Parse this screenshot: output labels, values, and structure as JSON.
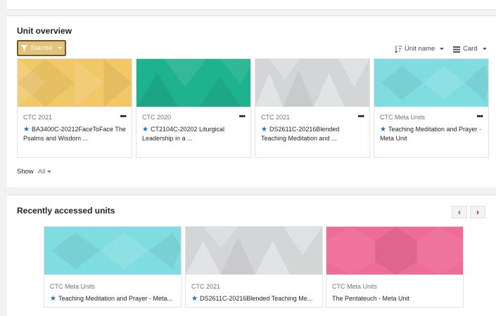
{
  "overview": {
    "title": "Unit overview",
    "filter_label": "Starred",
    "sort_label": "Unit name",
    "view_label": "Card",
    "show_label": "Show",
    "show_value": "All",
    "cards": [
      {
        "category": "CTC 2021",
        "title": "BA3400C-20212FaceToFace The Psalms and Wisdom ...",
        "starred": true,
        "color": "#f1c768"
      },
      {
        "category": "CTC 2020",
        "title": "CT2104C-20202 Liturgical Leadership in a ...",
        "starred": true,
        "color": "#1fb28f"
      },
      {
        "category": "CTC 2021",
        "title": "DS2611C-20216Blended Teaching Meditation and ...",
        "starred": true,
        "color": "#d3d5d6"
      },
      {
        "category": "CTC Meta Units",
        "title": "Teaching Meditation and Prayer - Meta Unit",
        "starred": true,
        "color": "#7fdcdf"
      }
    ]
  },
  "recent": {
    "title": "Recently accessed units",
    "prev_label": "‹",
    "next_label": "›",
    "cards": [
      {
        "category": "CTC Meta Units",
        "title": "Teaching Meditation and Prayer - Meta...",
        "starred": true,
        "color": "#7fdcdf"
      },
      {
        "category": "CTC 2021",
        "title": "DS2611C-20216Blended Teaching Me...",
        "starred": true,
        "color": "#d3d5d6"
      },
      {
        "category": "CTC Meta Units",
        "title": "The Pentateuch - Meta Unit",
        "starred": false,
        "color": "#ef6c97"
      }
    ]
  },
  "icons": {
    "filter": "filter-icon",
    "sort": "sort-alpha-icon",
    "view": "list-view-icon",
    "star": "star-icon",
    "menu": "more-dots-icon",
    "prev": "chevron-left-icon",
    "next": "chevron-right-icon"
  }
}
